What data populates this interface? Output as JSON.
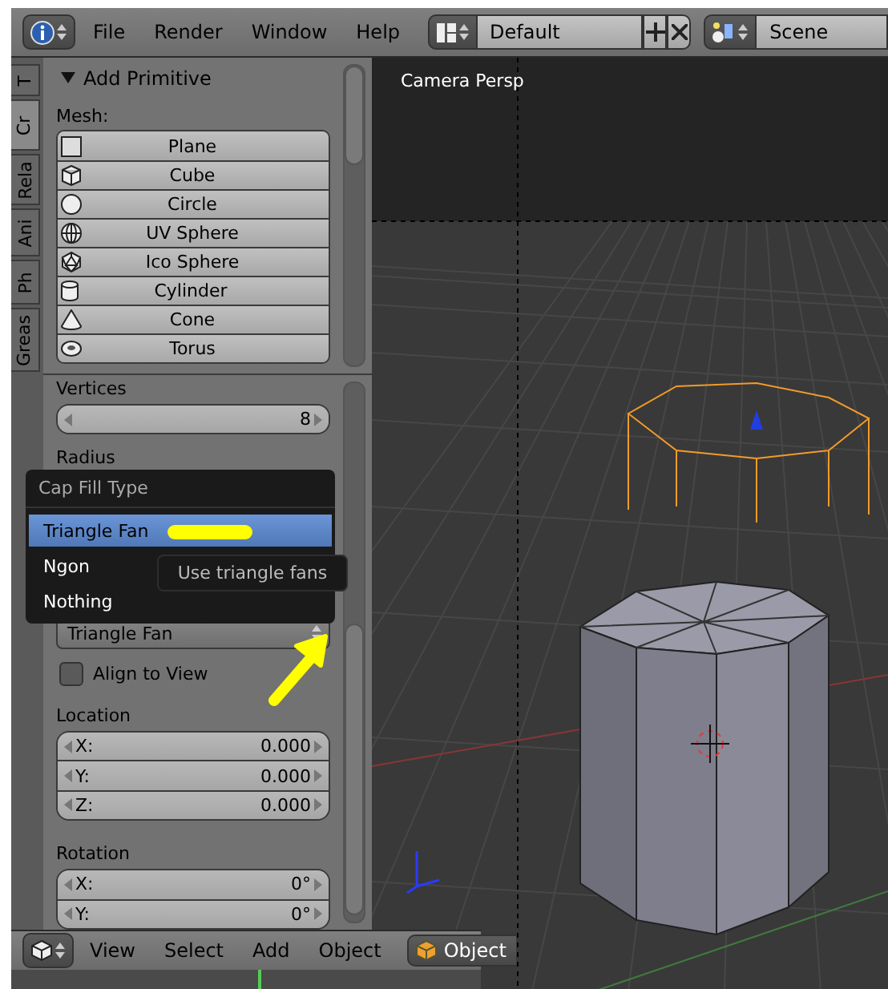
{
  "menubar": {
    "items": [
      "File",
      "Render",
      "Window",
      "Help"
    ]
  },
  "screen_layout": {
    "value": "Default"
  },
  "scene": {
    "value": "Scene"
  },
  "tool_tabs": [
    {
      "label": "T",
      "selected": false
    },
    {
      "label": "Cr",
      "selected": true
    },
    {
      "label": "Rela",
      "selected": false
    },
    {
      "label": "Ani",
      "selected": false
    },
    {
      "label": "Ph",
      "selected": false
    },
    {
      "label": "Greas",
      "selected": false
    }
  ],
  "add_primitive": {
    "title": "Add Primitive",
    "expanded": true,
    "section": "Mesh:",
    "items": [
      {
        "label": "Plane",
        "kind": "plane"
      },
      {
        "label": "Cube",
        "kind": "cube"
      },
      {
        "label": "Circle",
        "kind": "circle"
      },
      {
        "label": "UV Sphere",
        "kind": "uvsphere"
      },
      {
        "label": "Ico Sphere",
        "kind": "icosphere"
      },
      {
        "label": "Cylinder",
        "kind": "cylinder"
      },
      {
        "label": "Cone",
        "kind": "cone"
      },
      {
        "label": "Torus",
        "kind": "torus"
      }
    ]
  },
  "operator": {
    "vertices": {
      "label": "Vertices",
      "value": "8"
    },
    "radius": {
      "label": "Radius"
    },
    "cap_fill": {
      "value": "Triangle Fan"
    },
    "align_to_view": {
      "label": "Align to View",
      "checked": false
    },
    "location": {
      "label": "Location",
      "fields": [
        {
          "axis": "X:",
          "value": "0.000"
        },
        {
          "axis": "Y:",
          "value": "0.000"
        },
        {
          "axis": "Z:",
          "value": "0.000"
        }
      ]
    },
    "rotation": {
      "label": "Rotation",
      "fields": [
        {
          "axis": "X:",
          "value": "0°"
        },
        {
          "axis": "Y:",
          "value": "0°"
        }
      ]
    }
  },
  "popup_menu": {
    "title": "Cap Fill Type",
    "items": [
      {
        "label": "Triangle Fan",
        "selected": true
      },
      {
        "label": "Ngon",
        "selected": false
      },
      {
        "label": "Nothing",
        "selected": false
      }
    ]
  },
  "tooltip": {
    "text": "Use triangle fans"
  },
  "viewport": {
    "label": "Camera Persp"
  },
  "bottom_header": {
    "items": [
      "View",
      "Select",
      "Add",
      "Object"
    ],
    "mode": "Object"
  }
}
